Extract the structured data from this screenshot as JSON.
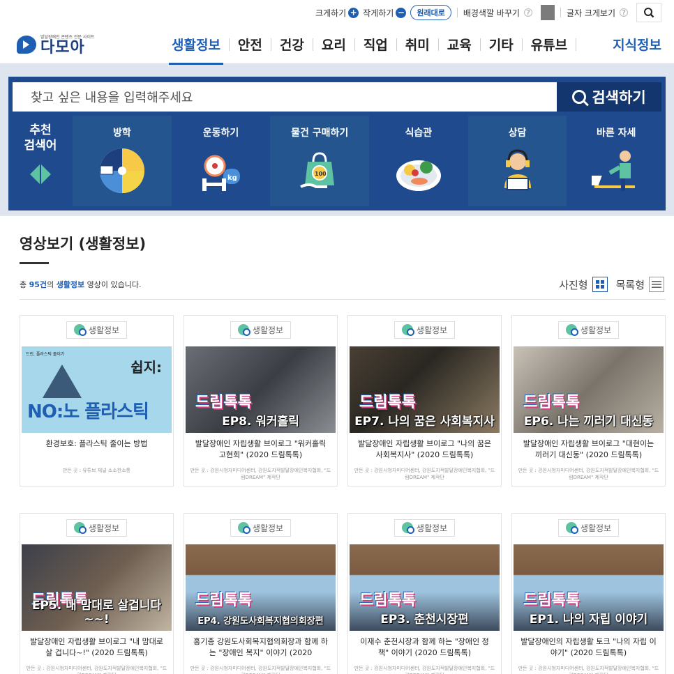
{
  "util": {
    "bigger": "크게하기",
    "smaller": "작게하기",
    "original": "원래대로",
    "bg_change": "배경색깔 바꾸기",
    "font_view": "글자 크게보기",
    "plus": "+",
    "minus": "−",
    "help": "?"
  },
  "header": {
    "logo_sub": "발달장애인 콘텐츠 전문 사이트",
    "logo_name": "다모아",
    "nav": [
      {
        "label": "생활정보"
      },
      {
        "label": "안전"
      },
      {
        "label": "건강"
      },
      {
        "label": "요리"
      },
      {
        "label": "직업"
      },
      {
        "label": "취미"
      },
      {
        "label": "교육"
      },
      {
        "label": "기타"
      },
      {
        "label": "유튜브"
      }
    ],
    "knowledge": "지식정보"
  },
  "search": {
    "placeholder": "찾고 싶은 내용을 입력해주세요",
    "button": "검색하기"
  },
  "recommend": {
    "lead_1": "추천",
    "lead_2": "검색어",
    "items": [
      {
        "label": "방학",
        "icon": "vacation-calendar-icon"
      },
      {
        "label": "운동하기",
        "icon": "exercise-kettlebell-icon"
      },
      {
        "label": "물건 구매하기",
        "icon": "shopping-bag-icon"
      },
      {
        "label": "식습관",
        "icon": "food-plate-icon"
      },
      {
        "label": "상담",
        "icon": "counseling-headset-icon"
      },
      {
        "label": "바른 자세",
        "icon": "posture-desk-icon"
      }
    ]
  },
  "section": {
    "title": "영상보기 (생활정보)",
    "count_prefix": "총 ",
    "count_num": "95건",
    "count_mid": "의 ",
    "count_cat": "생활정보",
    "count_suffix": " 영상이 있습니다.",
    "view_photo": "사진형",
    "view_list": "목록형"
  },
  "cards": [
    {
      "tag": "생활정보",
      "thumb_top": "드린, 플라스틱 줄이기",
      "thumb_title": "쉽지:",
      "thumb_big": "NO:노 플라스틱",
      "title": "환경보호: 플라스틱 줄이는 방법",
      "maker": "만든 곳 : 유튜브 채널 소소한소통"
    },
    {
      "tag": "생활정보",
      "thumb_logo": "드림톡톡",
      "thumb_cap": "EP8. 워커홀릭",
      "title": "발달장애인 자립생활 브이로그 \"워커홀릭 고현희\" (2020 드림톡톡)",
      "maker": "만든 곳 : 강원시청자미디어센터, 강원도지적발달장애인복지협회, \"드림DREAM\" 제작단"
    },
    {
      "tag": "생활정보",
      "thumb_logo": "드림톡톡",
      "thumb_cap": "EP7. 나의 꿈은 사회복지사",
      "title": "발달장애인 자립생활 브이로그 \"나의 꿈은 사회복지사\" (2020 드림톡톡)",
      "maker": "만든 곳 : 강원시청자미디어센터, 강원도지적발달장애인복지협회, \"드림DREAM\" 제작단"
    },
    {
      "tag": "생활정보",
      "thumb_logo": "드림톡톡",
      "thumb_cap": "EP6. 나는 끼러기 대신동",
      "title": "발달장애인 자립생활 브이로그 \"대현이는 끼러기 대신동\" (2020 드림톡톡)",
      "maker": "만든 곳 : 강원시청자미디어센터, 강원도지적발달장애인복지협회, \"드림DREAM\" 제작단"
    },
    {
      "tag": "생활정보",
      "thumb_logo": "드림톡톡",
      "thumb_cap": "EP5. 내 맘대로 살겁니다~~!",
      "title": "발달장애인 자립생활 브이로그 \"내 맘대로 살 겁니다~!\" (2020 드림톡톡)",
      "maker": "만든 곳 : 강원시청자미디어센터, 강원도지적발달장애인복지협회, \"드림DREAM\" 제작단"
    },
    {
      "tag": "생활정보",
      "thumb_logo": "드림톡톡",
      "thumb_cap": "EP4. 강원도사회복지협의회장편",
      "title": "홍기종 강원도사회복지협의회장과 함께 하는 \"장애인 복지\" 이야기 (2020",
      "maker": "만든 곳 : 강원시청자미디어센터, 강원도지적발달장애인복지협회, \"드림DREAM\" 제작단"
    },
    {
      "tag": "생활정보",
      "thumb_logo": "드림톡톡",
      "thumb_cap": "EP3. 춘천시장편",
      "title": "이재수 춘천시장과 함께 하는 \"장애인 정책\" 이야기 (2020 드림톡톡)",
      "maker": "만든 곳 : 강원시청자미디어센터, 강원도지적발달장애인복지협회, \"드림DREAM\" 제작단"
    },
    {
      "tag": "생활정보",
      "thumb_logo": "드림톡톡",
      "thumb_cap": "EP1. 나의 자립 이야기",
      "title": "발달장애인의 자립생활 토크 \"나의 자립 이야기\" (2020 드림톡톡)",
      "maker": "만든 곳 : 강원시청자미디어센터, 강원도지적발달장애인복지협회, \"드림DREAM\" 제작단"
    }
  ]
}
